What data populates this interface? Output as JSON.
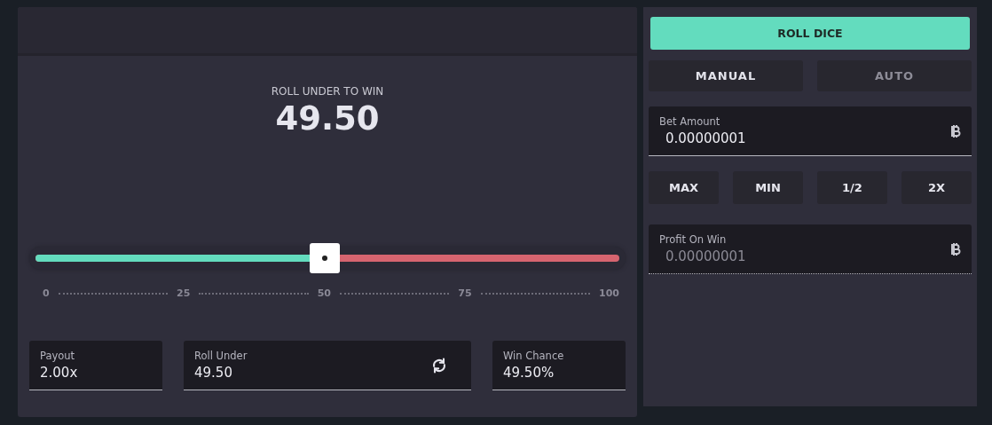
{
  "game": {
    "heading": "ROLL UNDER TO WIN",
    "value": "49.50"
  },
  "slider": {
    "level": 0.495,
    "ticks": [
      "0",
      "25",
      "50",
      "75",
      "100"
    ]
  },
  "stats": [
    {
      "label": "Payout",
      "value": "2.00x",
      "kind": "plain"
    },
    {
      "label": "Roll Under",
      "value": "49.50",
      "kind": "swap"
    },
    {
      "label": "Win Chance",
      "value": "49.50%",
      "kind": "plain"
    }
  ],
  "roll_button": "ROLL DICE",
  "tabs": [
    {
      "label": "MANUAL",
      "selected": true
    },
    {
      "label": "AUTO",
      "selected": false
    }
  ],
  "bet": {
    "label": "Bet Amount",
    "value": "0.00000001",
    "disabled": false
  },
  "bet_buttons": [
    "MAX",
    "MIN",
    "1/2",
    "2X"
  ],
  "profit": {
    "label": "Profit On Win",
    "value": "0.00000001",
    "disabled": true
  }
}
